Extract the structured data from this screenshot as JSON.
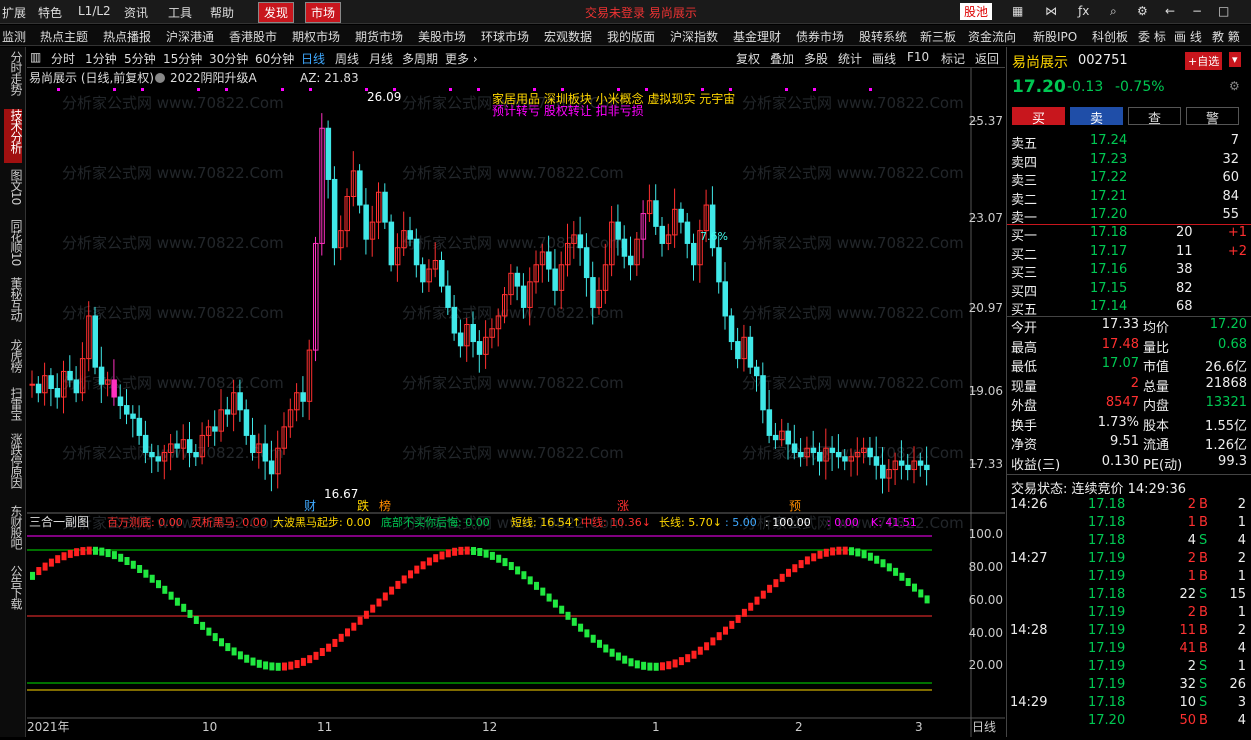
{
  "menubar": {
    "items": [
      "扩展",
      "特色",
      "L1/L2",
      "资讯",
      "工具",
      "帮助"
    ],
    "active": [
      "发现",
      "市场"
    ],
    "center": "交易未登录   易尚展示",
    "stock_pool": "股池"
  },
  "navbar": {
    "items": [
      "监测",
      "热点主题",
      "热点播报",
      "沪深港通",
      "香港股市",
      "期权市场",
      "期货市场",
      "美股市场",
      "环球市场",
      "宏观数据",
      "我的版面",
      "沪深指数",
      "基金理财",
      "债券市场",
      "股转系统",
      "新三板",
      "资金流向",
      "新股IPO",
      "科创板",
      "委 标",
      "画 线",
      "教 籁"
    ]
  },
  "leftbar": [
    "分时走势",
    "技术分析",
    "图文10",
    "同花顺10",
    "董秘互动",
    "龙虎榜",
    "扫雷宝",
    "涨跌停原因",
    "东财股吧",
    "公告下载"
  ],
  "periods": [
    "分时",
    "1分钟",
    "5分钟",
    "15分钟",
    "30分钟",
    "60分钟",
    "日线",
    "周线",
    "月线",
    "多周期",
    "更多 ›"
  ],
  "selected_period": "日线",
  "tools": [
    "复权",
    "叠加",
    "多股",
    "统计",
    "画线",
    "F10",
    "标记",
    "返回"
  ],
  "chart": {
    "title": "易尚展示 (日线,前复权)",
    "indicator": "2022阴阳升级A",
    "az": "AZ: 21.83",
    "concepts1": "家居用品 深圳板块 小米概念 虚拟现实 元宇宙",
    "concepts2": "预计转亏  股权转让  扣非亏损",
    "high_label": "26.09",
    "low_label": "16.67",
    "pct_label": "7.6%",
    "markers": [
      "财",
      "跌",
      "榜",
      "涨",
      "预"
    ],
    "price_ticks": [
      "25.37",
      "23.07",
      "20.97",
      "19.06",
      "17.33"
    ],
    "sub_ticks": [
      "100.0",
      "80.00",
      "60.00",
      "40.00",
      "20.00"
    ],
    "x_labels": [
      "2021年",
      "10",
      "11",
      "12",
      "1",
      "2",
      "3"
    ],
    "x_tail": "日线",
    "watermark": "分析家公式网 www.70822.Com"
  },
  "subchart": {
    "name": "三合一副图",
    "fields": [
      {
        "label": "百万测底: 0.00",
        "color": "#ff3030"
      },
      {
        "label": "灵析黑马: 0.00",
        "color": "#ff3030"
      },
      {
        "label": "大波黑马起步: 0.00",
        "color": "#ffd700"
      },
      {
        "label": "底部不买你后悔: 0.00",
        "color": "#00c853"
      },
      {
        "label": "短线: 16.54↑",
        "color": "#ffd700"
      },
      {
        "label": "中线: 10.36↓",
        "color": "#ff3030"
      },
      {
        "label": "长线: 5.70↓",
        "color": "#ffd700"
      },
      {
        "label": ": 5.00",
        "color": "#3fa9ff"
      },
      {
        "label": ": 100.00",
        "color": "#ffffff"
      },
      {
        "label": ": 0.00",
        "color": "#f0f"
      },
      {
        "label": "K: 41.51",
        "color": "#f0f"
      }
    ]
  },
  "quote": {
    "name": "易尚展示",
    "code": "002751",
    "add": "+自选",
    "price": "17.20",
    "change": "-0.13",
    "pct": "-0.75%",
    "buttons": [
      "买",
      "卖",
      "查",
      "警"
    ],
    "asks": [
      {
        "l": "卖五",
        "p": "17.24",
        "v": "7"
      },
      {
        "l": "卖四",
        "p": "17.23",
        "v": "32"
      },
      {
        "l": "卖三",
        "p": "17.22",
        "v": "60"
      },
      {
        "l": "卖二",
        "p": "17.21",
        "v": "84"
      },
      {
        "l": "卖一",
        "p": "17.20",
        "v": "55"
      }
    ],
    "bids": [
      {
        "l": "买一",
        "p": "17.18",
        "v": "20",
        "d": "+1"
      },
      {
        "l": "买二",
        "p": "17.17",
        "v": "11",
        "d": "+2"
      },
      {
        "l": "买三",
        "p": "17.16",
        "v": "38",
        "d": ""
      },
      {
        "l": "买四",
        "p": "17.15",
        "v": "82",
        "d": ""
      },
      {
        "l": "买五",
        "p": "17.14",
        "v": "68",
        "d": ""
      }
    ],
    "stats": [
      {
        "a": "今开",
        "av": "17.33",
        "ac": "wht",
        "b": "均价",
        "bv": "17.20",
        "bc": "green"
      },
      {
        "a": "最高",
        "av": "17.48",
        "ac": "red",
        "b": "量比",
        "bv": "0.68",
        "bc": "green"
      },
      {
        "a": "最低",
        "av": "17.07",
        "ac": "green",
        "b": "市值",
        "bv": "26.6亿",
        "bc": "wht"
      },
      {
        "a": "现量",
        "av": "2",
        "ac": "red",
        "b": "总量",
        "bv": "21868",
        "bc": "wht"
      },
      {
        "a": "外盘",
        "av": "8547",
        "ac": "red",
        "b": "内盘",
        "bv": "13321",
        "bc": "green"
      },
      {
        "a": "换手",
        "av": "1.73%",
        "ac": "wht",
        "b": "股本",
        "bv": "1.55亿",
        "bc": "wht"
      },
      {
        "a": "净资",
        "av": "9.51",
        "ac": "wht",
        "b": "流通",
        "bv": "1.26亿",
        "bc": "wht"
      },
      {
        "a": "收益(三)",
        "av": "0.130",
        "ac": "wht",
        "b": "PE(动)",
        "bv": "99.3",
        "bc": "wht"
      }
    ],
    "status": "交易状态: 连续竞价 14:29:36",
    "ticks": [
      {
        "t": "14:26",
        "p": "17.18",
        "v": "2",
        "s": "B",
        "n": "2"
      },
      {
        "t": "",
        "p": "17.18",
        "v": "1",
        "s": "B",
        "n": "1"
      },
      {
        "t": "",
        "p": "17.18",
        "v": "4",
        "s": "S",
        "n": "4"
      },
      {
        "t": "14:27",
        "p": "17.19",
        "v": "2",
        "s": "B",
        "n": "2"
      },
      {
        "t": "",
        "p": "17.19",
        "v": "1",
        "s": "B",
        "n": "1"
      },
      {
        "t": "",
        "p": "17.18",
        "v": "22",
        "s": "S",
        "n": "15"
      },
      {
        "t": "",
        "p": "17.19",
        "v": "2",
        "s": "B",
        "n": "1"
      },
      {
        "t": "14:28",
        "p": "17.19",
        "v": "11",
        "s": "B",
        "n": "2"
      },
      {
        "t": "",
        "p": "17.19",
        "v": "41",
        "s": "B",
        "n": "4"
      },
      {
        "t": "",
        "p": "17.19",
        "v": "2",
        "s": "S",
        "n": "1"
      },
      {
        "t": "",
        "p": "17.19",
        "v": "32",
        "s": "S",
        "n": "26"
      },
      {
        "t": "14:29",
        "p": "17.18",
        "v": "10",
        "s": "S",
        "n": "3"
      },
      {
        "t": "",
        "p": "17.20",
        "v": "50",
        "s": "B",
        "n": "4"
      }
    ]
  }
}
